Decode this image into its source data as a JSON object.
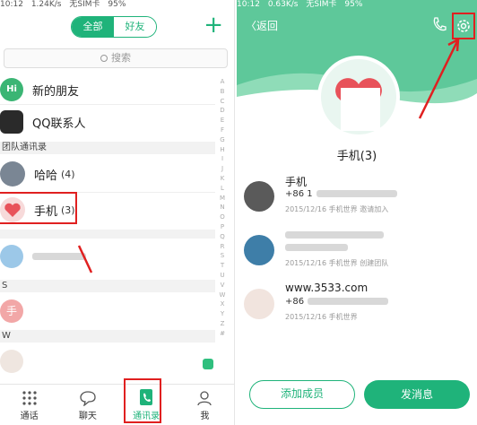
{
  "left": {
    "status": {
      "time": "10:12",
      "speed": "1.24K/s",
      "carrier": "无SIM卡",
      "battery": "95%"
    },
    "tabs": {
      "all": "全部",
      "friends": "好友"
    },
    "plus_glyph": "+",
    "search": {
      "placeholder": "搜索"
    },
    "rows": {
      "new_friends": "新的朋友",
      "qq": "QQ联系人",
      "team_header": "团队通讯录",
      "haha": "哈哈",
      "haha_count": "(4)",
      "phone": "手机",
      "phone_count": "(3)",
      "section_s": "S",
      "section_w": "W",
      "shou": "手"
    },
    "alphabet": [
      "A",
      "B",
      "C",
      "D",
      "E",
      "F",
      "G",
      "H",
      "I",
      "J",
      "K",
      "L",
      "M",
      "N",
      "O",
      "P",
      "Q",
      "R",
      "S",
      "T",
      "U",
      "V",
      "W",
      "X",
      "Y",
      "Z",
      "#"
    ],
    "tabbar": {
      "call": "通话",
      "chat": "聊天",
      "contacts": "通讯录",
      "me": "我"
    }
  },
  "right": {
    "status": {
      "time": "10:12",
      "speed": "0.63K/s",
      "carrier": "无SIM卡",
      "battery": "95%"
    },
    "back": "〈返回",
    "group_name": "手机",
    "group_count": "(3)",
    "members": [
      {
        "name": "手机",
        "phone": "+86 1",
        "meta": "2015/12/16  手机世界  邀请加入"
      },
      {
        "name": "",
        "phone": "",
        "meta": "2015/12/16  手机世界  创建团队"
      },
      {
        "name": "www.3533.com",
        "phone": "+86",
        "meta": "2015/12/16  手机世界"
      }
    ],
    "buttons": {
      "add": "添加成员",
      "message": "发消息"
    }
  },
  "colors": {
    "accent": "#1fb37a",
    "hero": "#5ec89a",
    "highlight": "#e02020"
  }
}
